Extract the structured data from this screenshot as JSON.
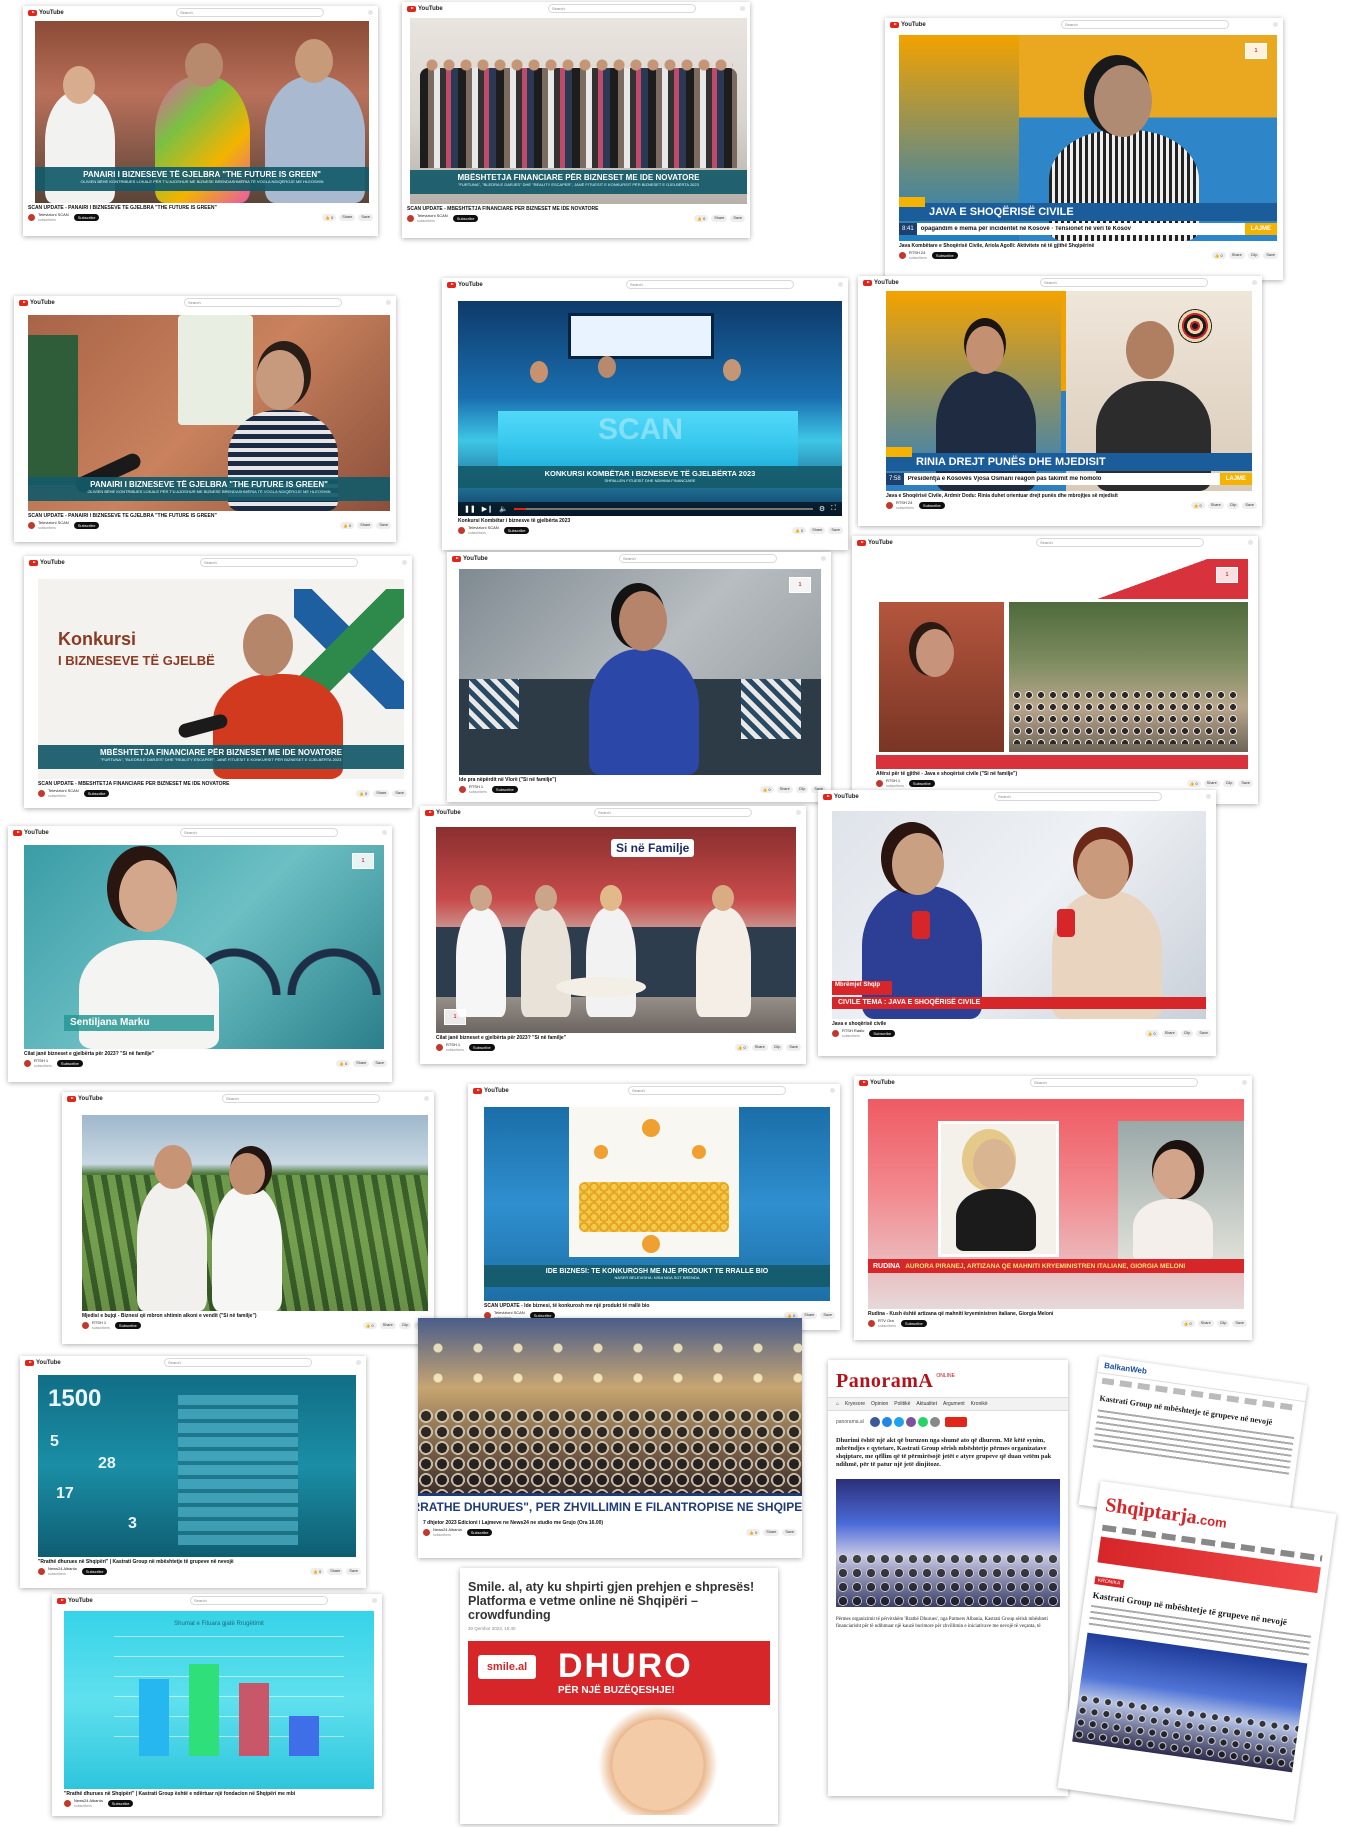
{
  "common": {
    "yt_logo": "YouTube",
    "search_placeholder": "Search",
    "subscribe": "Subscribe",
    "like_icon": "thumb-up-icon",
    "share": "Share",
    "clip": "Clip",
    "save": "Save"
  },
  "cards": [
    {
      "lower1": "PANAIRI I BIZNESEVE TË GJELBRA \"THE FUTURE IS GREEN\"",
      "lower2": "OLIVIEN BËHE KONTRIBUES LOKALE PËR T'U AJOSHUR ME BIZNESE BRENDASHMËRIA TË VOGLA NDIQËROJE ME HLEOSHIN",
      "title": "SCAN UPDATE - PANAIRI I BIZNESEVE TË GJELBRA \"THE FUTURE IS GREEN\"",
      "channel": "Televizioni SCAN",
      "subs": "subscribers"
    },
    {
      "lower1": "MBËSHTETJA FINANCIARE PËR BIZNESET ME IDE NOVATORE",
      "lower2": "\"FURTUNA\", \"BLEDRA E DARJES\" DHE \"REALITY ESCAPER\", JANË FITUESIT E KONKURSIT PËR BIZNESET E GJELBËRTA 2023",
      "title": "SCAN UPDATE - MBËSHTETJA FINANCIARE PËR BIZNESET ME IDE NOVATORE",
      "channel": "Televizioni SCAN",
      "subs": "subscribers"
    },
    {
      "lower1": "JAVA E SHOQËRISË CIVILE",
      "ticker": "opagandim e mema për incidentet në Kosovë  ·  Tensionet në veri të Kosov",
      "time": "8:41",
      "lajme": "LAJME",
      "title": "Java Kombëtare e Shoqërisë Civile, Ariola Agolli: Aktivitete në të gjithë Shqipërinë",
      "channel": "RTSH 24",
      "subs": "subscribers"
    },
    {
      "lower1": "PANAIRI I BIZNESEVE TË GJELBRA \"THE FUTURE IS GREEN\"",
      "lower2": "OLIVIEN BËHE KONTRIBUES LOKALE PËR T'U AJOSHUR ME BIZNESE BRENDASHMËRIA TË VOGLA NDIQËROJE ME HLEOSHIN",
      "title": "SCAN UPDATE - PANAIRI I BIZNESEVE TË GJELBRA \"THE FUTURE IS GREEN\"",
      "channel": "Televizioni SCAN",
      "subs": "subscribers"
    },
    {
      "lower1": "KONKURSI KOMBËTAR I BIZNESEVE TË GJELBËRTA 2023",
      "lower2": "SHPALLEN FITUESIT DHE NDIHMA FINANCIARE",
      "screen": "SCAN",
      "title": "Konkursi Kombëtar i biznesve të gjelbërta 2023",
      "channel": "Televizioni SCAN",
      "subs": "subscribers"
    },
    {
      "lower1": "RINIA DREJT PUNËS DHE MJEDISIT",
      "ticker": "Presidentja e Kosovës Vjosa Osmani reagon pas takimit me homolo",
      "time": "7:58",
      "lajme": "LAJME",
      "title": "Java e Shoqërisë Civile, Ardmir Dodu: Rinia duhet orientuar drejt punës dhe mbrojtjes së mjedisit",
      "channel": "RTSH 24",
      "subs": "subscribers"
    },
    {
      "big1": "Konkursi",
      "big2": "I BIZNESEVE TË GJELBË",
      "lower1": "MBËSHTETJA FINANCIARE PËR BIZNESET ME IDE NOVATORE",
      "lower2": "\"FURTUNA\", \"BLEDRA E DARJES\" DHE \"REALITY ESCAPER\", JANË FITUESIT E KONKURSIT PËR BIZNESET E GJELBËRTA 2023",
      "title": "SCAN UPDATE - MBËSHTETJA FINANCIARE PËR BIZNESET ME IDE NOVATORE",
      "channel": "Televizioni SCAN",
      "subs": "subscribers"
    },
    {
      "title": "Ide pra nëpërdit në Vlorë (\"Si në familje\")",
      "channel": "RTSH 1",
      "subs": "subscribers"
    },
    {
      "title": "Afërsi për të gjithë - Java e shoqërisë civile (\"Si në familje\")",
      "channel": "RTSH 1",
      "subs": "subscribers"
    },
    {
      "name": "Sentiljana Marku",
      "title": "Cilat janë bizneset e gjelbërta për 2023? \"Si në familje\"",
      "channel": "RTSH 1",
      "subs": "subscribers"
    },
    {
      "logo": "Si në Familje",
      "title": "Cilat janë bizneset e gjelbërta për 2023? \"Si në familje\"",
      "channel": "RTSH 1",
      "subs": "subscribers"
    },
    {
      "lower1": "CIVILE   TEMA : JAVA E SHOQËRISË CIVILE",
      "tag": "Mbrëmjet Shqip",
      "title": "Java e shoqërisë civile",
      "channel": "RTSH Radio",
      "subs": "subscribers"
    },
    {
      "title": "Mjedisi e bujqi - Biznesi që mbron shtimin alkoni e vendit (\"Si në familje\")",
      "channel": "RTSH 1",
      "subs": "subscribers"
    },
    {
      "lower1": "IDE BIZNESI: TË KONKUROSH ME NJË PRODUKT TË RRALLË BIO",
      "lower2": "NASER BELEVISHA: NISA NGA SOT BRENDA",
      "title": "SCAN UPDATE - Ide biznesi, të konkurosh me një produkt të rrallë bio",
      "channel": "Televizioni SCAN",
      "subs": "subscribers"
    },
    {
      "lower1": "AURORA PIRANEJ, ARTIZANA QË MAHNITI KRYEMINISTREN ITALIANE, GIORGIA MELONI",
      "label": "RUDINA",
      "title": "Rudina - Kush është artizana që mahniti kryeministren italiane, Giorgia Meloni",
      "channel": "RTV Ora",
      "subs": "subscribers"
    },
    {
      "n1": "1500",
      "n2": "5",
      "n3": "28",
      "n4": "17",
      "n5": "3",
      "title": "\"Rrathë dhurues në Shqipëri\" | Kastrati Group në mbështetje të grupeve në nevojë",
      "channel": "News24 Albania",
      "subs": "subscribers"
    },
    {
      "title_strip": "\"RRATHE DHURUES\", PER ZHVILLIMIN E FILANTROPISE NE SHQIPERI",
      "title": "7 dhjetor 2023 Edicioni i Lajmeve ne News24 ne studio me Grujo (Ora 16.00)",
      "channel": "News24 Albania",
      "subs": "subscribers"
    },
    {
      "logo": "PanoramA",
      "logo_sup": "ONLINE",
      "nav": [
        "Kryesore",
        "Opinion",
        "Politikë",
        "Aktualitet",
        "Argument",
        "Kronikë"
      ],
      "byline": "panorama.al",
      "body": "Dhurimi është një akt që buruzon nga shumë ato që dhurem. Më këtë synim, mbrëndjes e qytetare, Kastrati Group sërish mbështetje përmes organizatave shqiptare, me qëllim që të përmirësojë jetët e atyre grupeve që duan vetëm pak ndihmë, për të patur një jetë dinjitoze.",
      "footer": "Përmes organizimit të përvitshëm 'Rrathë Dhurues', nga Partners Albania, Kastrati Group sërish mbështeti financiarisht për të ndihmuar një kauzë burimore për zhvillimin e iniciativave me nevojë të veçanta, të"
    },
    {
      "headline": "Kastrati Group në mbështetje të grupeve në nevojë",
      "brand": "BalkanWeb"
    },
    {
      "logo": "Shqiptarja",
      "logo_tld": ".com",
      "headline": "Kastrati Group në mbështetje të grupeve në nevojë",
      "tag": "KRONIKA"
    },
    {
      "chart_title": "Shumat e Fituara gjatë Rrugëtimit",
      "title": "\"Rrathë dhurues në Shqipëri\" | Kastrati Group është e ndërtuar një fondacion në Shqipëri me mbi",
      "channel": "News24 Albania",
      "subs": "subscribers"
    },
    {
      "headline": "Smile. al, aty ku shpirti gjen prehjen e shpresës! Platforma e vetme online në Shqipëri – crowdfunding",
      "date": "30 Qershor 2023, 15:40",
      "brand": "smile.al",
      "dhuro": "DHURO",
      "dhuro2": "PËR NJË BUZËQESHJE!"
    }
  ],
  "colors": {
    "yt_red": "#e1251b",
    "scan_teal": "#1d6e7a",
    "rtsh_orange": "#f5a800",
    "rtsh_blue": "#1b6fb3",
    "red": "#d6262a"
  }
}
